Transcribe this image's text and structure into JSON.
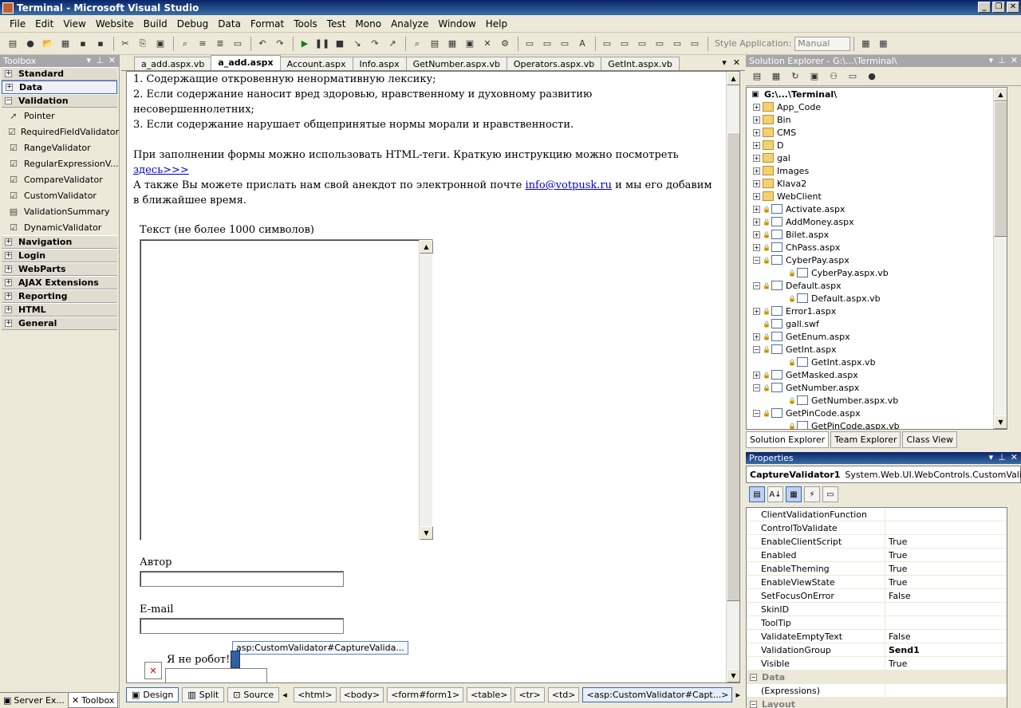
{
  "window": {
    "title": "Terminal - Microsoft Visual Studio"
  },
  "menu": [
    "File",
    "Edit",
    "View",
    "Website",
    "Build",
    "Debug",
    "Data",
    "Format",
    "Tools",
    "Test",
    "Mono",
    "Analyze",
    "Window",
    "Help"
  ],
  "toolbar": {
    "style_application_label": "Style Application:",
    "style_application_value": "Manual"
  },
  "toolbox": {
    "title": "Toolbox",
    "categories_top": [
      {
        "label": "Standard",
        "sign": "+"
      },
      {
        "label": "Data",
        "sign": "+"
      },
      {
        "label": "Validation",
        "sign": "−"
      }
    ],
    "items": [
      "Pointer",
      "RequiredFieldValidator",
      "RangeValidator",
      "RegularExpressionV...",
      "CompareValidator",
      "CustomValidator",
      "ValidationSummary",
      "DynamicValidator"
    ],
    "categories_bottom": [
      "Navigation",
      "Login",
      "WebParts",
      "AJAX Extensions",
      "Reporting",
      "HTML",
      "General"
    ],
    "bottom_tabs": [
      "Server Ex...",
      "Toolbox"
    ]
  },
  "editor": {
    "tabs": [
      "a_add.aspx.vb",
      "a_add.aspx",
      "Account.aspx",
      "Info.aspx",
      "GetNumber.aspx.vb",
      "Operators.aspx.vb",
      "GetInt.aspx.vb"
    ],
    "active_tab": 1,
    "lines": [
      "1. Содержащие откровенную ненормативную лексику;",
      "2. Если содержание наносит вред здоровью, нравственному и духовному развитию несовершеннолетних;",
      "3. Если содержание нарушает общепринятые нормы морали и нравственности."
    ],
    "html_hint": "При заполнении формы можно использовать HTML-теги. Краткую инструкцию можно посмотреть",
    "here_link": "здесь>>>",
    "email_text_before": "А также Вы можете прислать нам свой анекдот по электронной почте",
    "email_link": "info@votpusk.ru",
    "email_text_after": "и мы его добавим в ближайшее время.",
    "text_label": "Текст (не более 1000 символов)",
    "author_label": "Автор",
    "email_label": "E-mail",
    "robot_label": "Я не робот!",
    "tag_tooltip": "asp:CustomValidator#CaptureValida...",
    "view_buttons": [
      "Design",
      "Split",
      "Source"
    ],
    "breadcrumbs": [
      "<html>",
      "<body>",
      "<form#form1>",
      "<table>",
      "<tr>",
      "<td>",
      "<asp:CustomValidator#Capt...>"
    ]
  },
  "solution_explorer": {
    "title": "Solution Explorer - G:\\...\\Terminal\\",
    "root": "G:\\...\\Terminal\\",
    "nodes": [
      {
        "label": "App_Code",
        "type": "folder",
        "depth": 1,
        "sign": "+"
      },
      {
        "label": "Bin",
        "type": "folder",
        "depth": 1,
        "sign": "+"
      },
      {
        "label": "CMS",
        "type": "folder",
        "depth": 1,
        "sign": "+"
      },
      {
        "label": "D",
        "type": "folder",
        "depth": 1,
        "sign": "+"
      },
      {
        "label": "gal",
        "type": "folder",
        "depth": 1,
        "sign": "+"
      },
      {
        "label": "Images",
        "type": "folder",
        "depth": 1,
        "sign": "+"
      },
      {
        "label": "Klava2",
        "type": "folder",
        "depth": 1,
        "sign": "+"
      },
      {
        "label": "WebClient",
        "type": "folder",
        "depth": 1,
        "sign": "+"
      },
      {
        "label": "Activate.aspx",
        "type": "page",
        "depth": 1,
        "sign": "+"
      },
      {
        "label": "AddMoney.aspx",
        "type": "page",
        "depth": 1,
        "sign": "+"
      },
      {
        "label": "Bilet.aspx",
        "type": "page",
        "depth": 1,
        "sign": "+"
      },
      {
        "label": "ChPass.aspx",
        "type": "page",
        "depth": 1,
        "sign": "+"
      },
      {
        "label": "CyberPay.aspx",
        "type": "page",
        "depth": 1,
        "sign": "−"
      },
      {
        "label": "CyberPay.aspx.vb",
        "type": "page",
        "depth": 2,
        "sign": ""
      },
      {
        "label": "Default.aspx",
        "type": "page",
        "depth": 1,
        "sign": "−"
      },
      {
        "label": "Default.aspx.vb",
        "type": "page",
        "depth": 2,
        "sign": ""
      },
      {
        "label": "Error1.aspx",
        "type": "page",
        "depth": 1,
        "sign": "+"
      },
      {
        "label": "gall.swf",
        "type": "page",
        "depth": 1,
        "sign": ""
      },
      {
        "label": "GetEnum.aspx",
        "type": "page",
        "depth": 1,
        "sign": "+"
      },
      {
        "label": "GetInt.aspx",
        "type": "page",
        "depth": 1,
        "sign": "−"
      },
      {
        "label": "GetInt.aspx.vb",
        "type": "page",
        "depth": 2,
        "sign": ""
      },
      {
        "label": "GetMasked.aspx",
        "type": "page",
        "depth": 1,
        "sign": "+"
      },
      {
        "label": "GetNumber.aspx",
        "type": "page",
        "depth": 1,
        "sign": "−"
      },
      {
        "label": "GetNumber.aspx.vb",
        "type": "page",
        "depth": 2,
        "sign": ""
      },
      {
        "label": "GetPinCode.aspx",
        "type": "page",
        "depth": 1,
        "sign": "−"
      },
      {
        "label": "GetPinCode.aspx.vb",
        "type": "page",
        "depth": 2,
        "sign": ""
      }
    ],
    "tabs": [
      "Solution Explorer",
      "Team Explorer",
      "Class View"
    ]
  },
  "properties": {
    "title": "Properties",
    "object_name": "CaptureValidator1",
    "object_type": "System.Web.UI.WebControls.CustomValidat",
    "rows": [
      {
        "name": "ClientValidationFunction",
        "value": ""
      },
      {
        "name": "ControlToValidate",
        "value": ""
      },
      {
        "name": "EnableClientScript",
        "value": "True"
      },
      {
        "name": "Enabled",
        "value": "True"
      },
      {
        "name": "EnableTheming",
        "value": "True"
      },
      {
        "name": "EnableViewState",
        "value": "True"
      },
      {
        "name": "SetFocusOnError",
        "value": "False"
      },
      {
        "name": "SkinID",
        "value": ""
      },
      {
        "name": "ToolTip",
        "value": ""
      },
      {
        "name": "ValidateEmptyText",
        "value": "False"
      },
      {
        "name": "ValidationGroup",
        "value": "Send1",
        "bold": true
      },
      {
        "name": "Visible",
        "value": "True"
      }
    ],
    "categories": [
      "Data",
      "Layout"
    ],
    "expressions_label": "(Expressions)"
  }
}
